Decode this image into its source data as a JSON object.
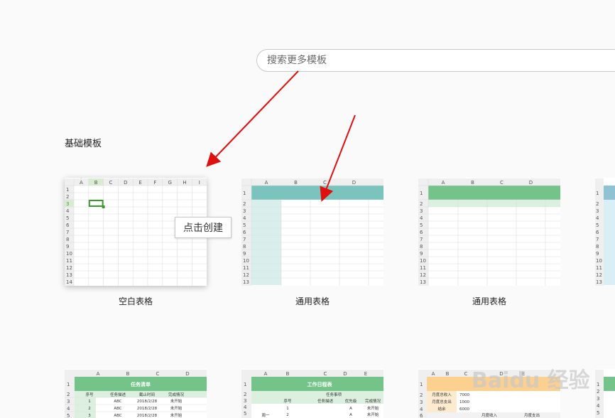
{
  "search": {
    "placeholder": "搜索更多模板"
  },
  "section": {
    "title": "基础模板"
  },
  "tooltip": {
    "label": "点击创建"
  },
  "cards": [
    {
      "label": "空白表格"
    },
    {
      "label": "通用表格"
    },
    {
      "label": "通用表格"
    }
  ],
  "blank_sheet": {
    "columns": [
      "A",
      "B",
      "C",
      "D",
      "E",
      "F",
      "G",
      "H",
      "I"
    ],
    "rows": [
      "1",
      "2",
      "3",
      "4",
      "5",
      "6",
      "7",
      "8",
      "9",
      "10",
      "11",
      "12",
      "13",
      "14"
    ]
  },
  "general_sheet": {
    "columns": [
      "A",
      "B",
      "C",
      "D"
    ],
    "rows": [
      "1",
      "2",
      "3",
      "4",
      "5",
      "6",
      "7",
      "8",
      "9",
      "10",
      "11",
      "12",
      "13"
    ]
  },
  "task_list": {
    "columns": [
      "A",
      "B",
      "C",
      "D"
    ],
    "title": "任务清单",
    "headers": [
      "序号",
      "任务描述",
      "截止时间",
      "完成情况"
    ],
    "rows": [
      [
        "1",
        "ABC",
        "2018/2/28",
        "未开始"
      ],
      [
        "2",
        "ABC",
        "2018/2/28",
        "未开始"
      ],
      [
        "3",
        "ABC",
        "2018/2/28",
        "未开始"
      ]
    ]
  },
  "schedule": {
    "columns": [
      "A",
      "B",
      "C",
      "D",
      "E"
    ],
    "title": "工作日程表",
    "subheader": "任务事项",
    "headers": [
      "序号",
      "任务描述",
      "优先级",
      "完成情况"
    ],
    "rows": [
      [
        "1",
        "",
        "A",
        "未开始"
      ],
      [
        "2",
        "",
        "A",
        "未开始"
      ]
    ],
    "side_label": "周一"
  },
  "budget": {
    "columns": [
      "A",
      "B",
      "C",
      "D",
      "E"
    ],
    "items": [
      [
        "月度总收入",
        "7000"
      ],
      [
        "月度总支出",
        "1000"
      ],
      [
        "结余",
        "6000"
      ]
    ],
    "footer": [
      "月度收入",
      "月度支出"
    ]
  },
  "watermark": "Baidu 经验",
  "colors": {
    "teal": "#7ac4bd",
    "teal_light": "#d8efec",
    "green": "#74c48a",
    "green_light": "#dbf0df",
    "orange": "#fcd08f",
    "arrow": "#e01010"
  }
}
